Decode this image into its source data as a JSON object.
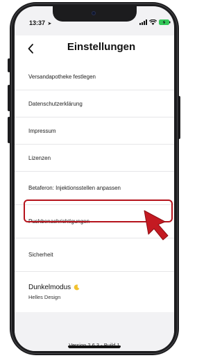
{
  "status_bar": {
    "time": "13:37",
    "location_glyph": "➤"
  },
  "header": {
    "title": "Einstellungen",
    "back_icon": "chevron-left-icon"
  },
  "settings": {
    "items": [
      {
        "label": "Versandapotheke festlegen"
      },
      {
        "label": "Datenschutzerklärung"
      },
      {
        "label": "Impressum"
      },
      {
        "label": "Lizenzen"
      },
      {
        "label": "Betaferon: Injektionsstellen anpassen"
      },
      {
        "label": "Pushbenachrichtigungen"
      },
      {
        "label": "Sicherheit"
      }
    ],
    "dark_mode": {
      "title": "Dunkelmodus",
      "subtitle": "Helles Design",
      "icon": "moon-icon"
    }
  },
  "footer": {
    "version": "Version 2.6.3 - Build 1"
  },
  "annotation": {
    "highlight_color": "#b5121b",
    "pointer_icon": "cursor-arrow-icon",
    "highlighted_item": "Pushbenachrichtigungen"
  }
}
